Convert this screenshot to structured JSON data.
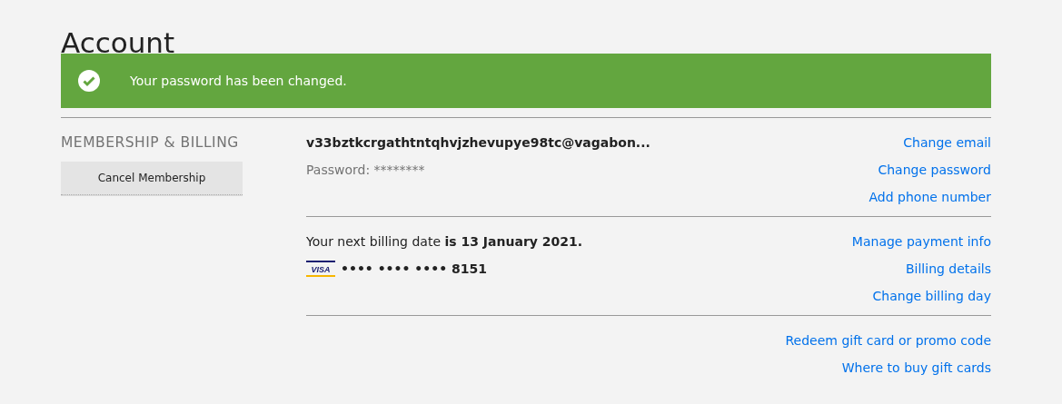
{
  "title": "Account",
  "banner": {
    "message": "Your password has been changed."
  },
  "section": {
    "heading": "MEMBERSHIP & BILLING",
    "button": "Cancel Membership",
    "groups": [
      {
        "rows": [
          {
            "kind": "email",
            "text": "v33bztkcrgathtntqhvjzhevupye98tc@vagabon...",
            "link": "Change email"
          },
          {
            "kind": "password",
            "text": "Password: ********",
            "link": "Change password"
          },
          {
            "kind": "none",
            "link": "Add phone number"
          }
        ]
      },
      {
        "rows": [
          {
            "kind": "text",
            "text": "Your next billing date **is 13 January 2021.**",
            "link": "Manage payment info"
          },
          {
            "kind": "card",
            "brand": "VISA",
            "text": "•••• •••• •••• 8151",
            "link": "Billing details"
          },
          {
            "kind": "none",
            "link": "Change billing day"
          }
        ]
      },
      {
        "rows": [
          {
            "kind": "none",
            "link": "Redeem gift card or promo code"
          },
          {
            "kind": "none",
            "link": "Where to buy gift cards"
          }
        ]
      }
    ]
  }
}
